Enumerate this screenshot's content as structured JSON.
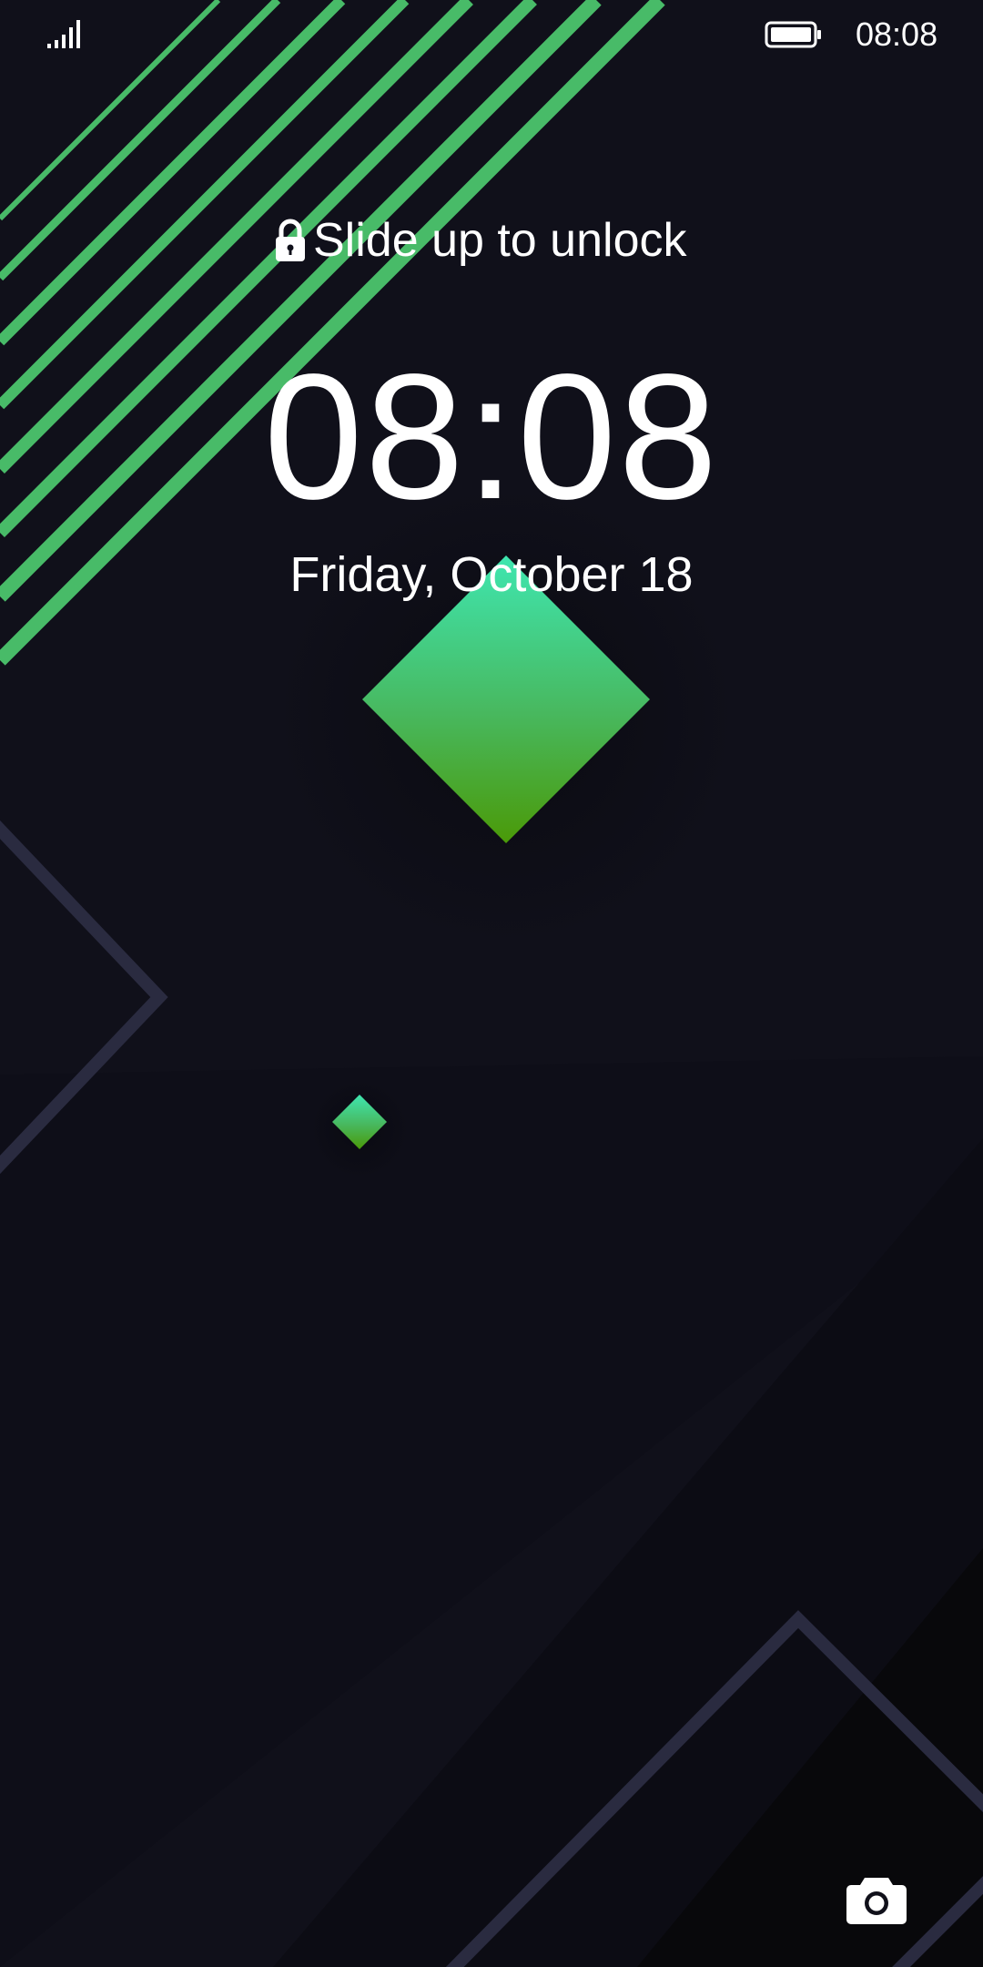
{
  "status_bar": {
    "time": "08:08",
    "signal_icon": "signal-bars-icon",
    "battery_icon": "battery-full-icon"
  },
  "lockscreen": {
    "unlock_hint": "Slide up to unlock",
    "lock_icon": "lock-icon",
    "clock": "08:08",
    "date": "Friday, October 18",
    "camera_icon": "camera-icon"
  },
  "colors": {
    "background": "#10101a",
    "accent_green_light": "#3fe0a8",
    "accent_green_dark": "#4a9a0c",
    "stripe_green": "#47c06e",
    "outline_navy": "#2a2b40",
    "text": "#ffffff"
  }
}
